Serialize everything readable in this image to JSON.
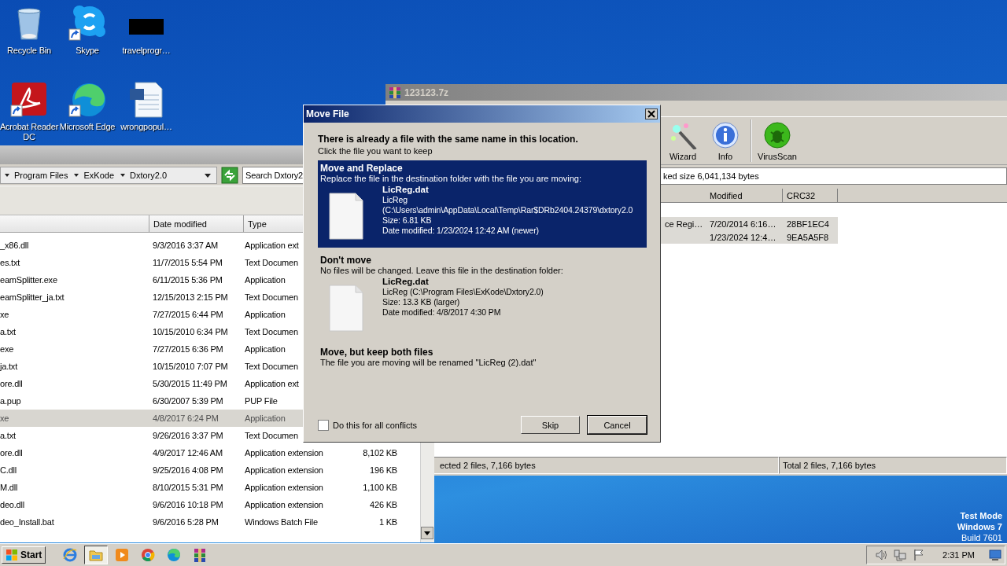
{
  "desktop": {
    "icons": [
      {
        "label": "Recycle Bin",
        "kind": "recycle",
        "shortcut": false
      },
      {
        "label": "Skype",
        "kind": "chat",
        "shortcut": true
      },
      {
        "label": "travelprogr…",
        "kind": "blackbox",
        "shortcut": false
      },
      {
        "label": "Acrobat Reader DC",
        "kind": "pdf",
        "shortcut": true
      },
      {
        "label": "Microsoft Edge",
        "kind": "edge",
        "shortcut": true
      },
      {
        "label": "wrongpopul…",
        "kind": "word",
        "shortcut": false
      }
    ],
    "os_notice": [
      "Test Mode",
      "Windows 7",
      "Build 7601"
    ]
  },
  "archiver": {
    "title": "123123.7z",
    "toolbar": [
      {
        "label": "Wizard",
        "kind": "wizard"
      },
      {
        "label": "Info",
        "kind": "info"
      },
      {
        "label": "VirusScan",
        "kind": "virus"
      }
    ],
    "path": "ked size 6,041,134 bytes",
    "columns": [
      "Modified",
      "CRC32"
    ],
    "rows": [
      {
        "description": "ce Regi…",
        "modified": "7/20/2014 6:16…",
        "crc32": "28BF1EC4",
        "selected": true
      },
      {
        "modified": "1/23/2024 12:4…",
        "crc32": "9EA5A5F8",
        "selected": true
      }
    ],
    "status": [
      "ected 2 files, 7,166 bytes",
      "Total 2 files, 7,166 bytes"
    ]
  },
  "explorer": {
    "breadcrumbs": [
      "Program Files",
      "ExKode",
      "Dxtory2.0"
    ],
    "search": {
      "placeholder": "Search Dxtory2"
    },
    "columns": [
      "Date modified",
      "Type"
    ],
    "rows": [
      {
        "name": "_x86.dll",
        "date": "9/3/2016 3:37 AM",
        "type": "Application ext",
        "selected": false
      },
      {
        "name": "es.txt",
        "date": "11/7/2015 5:54 PM",
        "type": "Text Documen",
        "selected": false
      },
      {
        "name": "eamSplitter.exe",
        "date": "6/11/2015 5:36 PM",
        "type": "Application",
        "selected": false
      },
      {
        "name": "eamSplitter_ja.txt",
        "date": "12/15/2013 2:15 PM",
        "type": "Text Documen",
        "selected": false
      },
      {
        "name": "xe",
        "date": "7/27/2015 6:44 PM",
        "type": "Application",
        "selected": false
      },
      {
        "name": "a.txt",
        "date": "10/15/2010 6:34 PM",
        "type": "Text Documen",
        "selected": false
      },
      {
        "name": "exe",
        "date": "7/27/2015 6:36 PM",
        "type": "Application",
        "selected": false
      },
      {
        "name": "ja.txt",
        "date": "10/15/2010 7:07 PM",
        "type": "Text Documen",
        "selected": false
      },
      {
        "name": "ore.dll",
        "date": "5/30/2015 11:49 PM",
        "type": "Application ext",
        "selected": false
      },
      {
        "name": "a.pup",
        "date": "6/30/2007 5:39 PM",
        "type": "PUP File",
        "selected": false
      },
      {
        "name": "xe",
        "date": "4/8/2017 6:24 PM",
        "type": "Application",
        "selected": true
      },
      {
        "name": "a.txt",
        "date": "9/26/2016 3:37 PM",
        "type": "Text Documen",
        "selected": false
      },
      {
        "name": "ore.dll",
        "date": "4/9/2017 12:46 AM",
        "type": "Application extension",
        "size": "8,102 KB",
        "selected": false
      },
      {
        "name": "C.dll",
        "date": "9/25/2016 4:08 PM",
        "type": "Application extension",
        "size": "196 KB",
        "selected": false
      },
      {
        "name": "M.dll",
        "date": "8/10/2015 5:31 PM",
        "type": "Application extension",
        "size": "1,100 KB",
        "selected": false
      },
      {
        "name": "deo.dll",
        "date": "9/6/2016 10:18 PM",
        "type": "Application extension",
        "size": "426 KB",
        "selected": false
      },
      {
        "name": "deo_Install.bat",
        "date": "9/6/2016 5:28 PM",
        "type": "Windows Batch File",
        "size": "1 KB",
        "selected": false
      }
    ]
  },
  "dialog": {
    "title": "Move File",
    "heading": "There is already a file with the same name in this location.",
    "subheading": "Click the file you want to keep",
    "options": [
      {
        "title": "Move and Replace",
        "description": "Replace the file in the destination folder with the file you are moving:",
        "selected": true,
        "file": {
          "name": "LicReg.dat",
          "details": [
            "LicReg",
            "(C:\\Users\\admin\\AppData\\Local\\Temp\\Rar$DRb2404.24379\\dxtory2.0",
            "Size: 6.81 KB",
            "Date modified: 1/23/2024 12:42 AM (newer)"
          ]
        }
      },
      {
        "title": "Don't move",
        "description": "No files will be changed. Leave this file in the destination folder:",
        "selected": false,
        "file": {
          "name": "LicReg.dat",
          "details": [
            "LicReg (C:\\Program Files\\ExKode\\Dxtory2.0)",
            "Size: 13.3 KB (larger)",
            "Date modified: 4/8/2017 4:30 PM"
          ]
        }
      },
      {
        "title": "Move, but keep both files",
        "description": "The file you are moving will be renamed \"LicReg (2).dat\"",
        "selected": false
      }
    ],
    "checkbox": {
      "label": "Do this for all conflicts",
      "checked": false
    },
    "buttons": [
      {
        "label": "Skip",
        "default": false
      },
      {
        "label": "Cancel",
        "default": true
      }
    ]
  },
  "taskbar": {
    "start": "Start",
    "apps": [
      {
        "kind": "ie",
        "active": false
      },
      {
        "kind": "folder",
        "active": true
      },
      {
        "kind": "media",
        "active": false
      },
      {
        "kind": "chrome",
        "active": false
      },
      {
        "kind": "edge",
        "active": false
      },
      {
        "kind": "archive",
        "active": false
      }
    ],
    "clock": "2:31 PM"
  }
}
